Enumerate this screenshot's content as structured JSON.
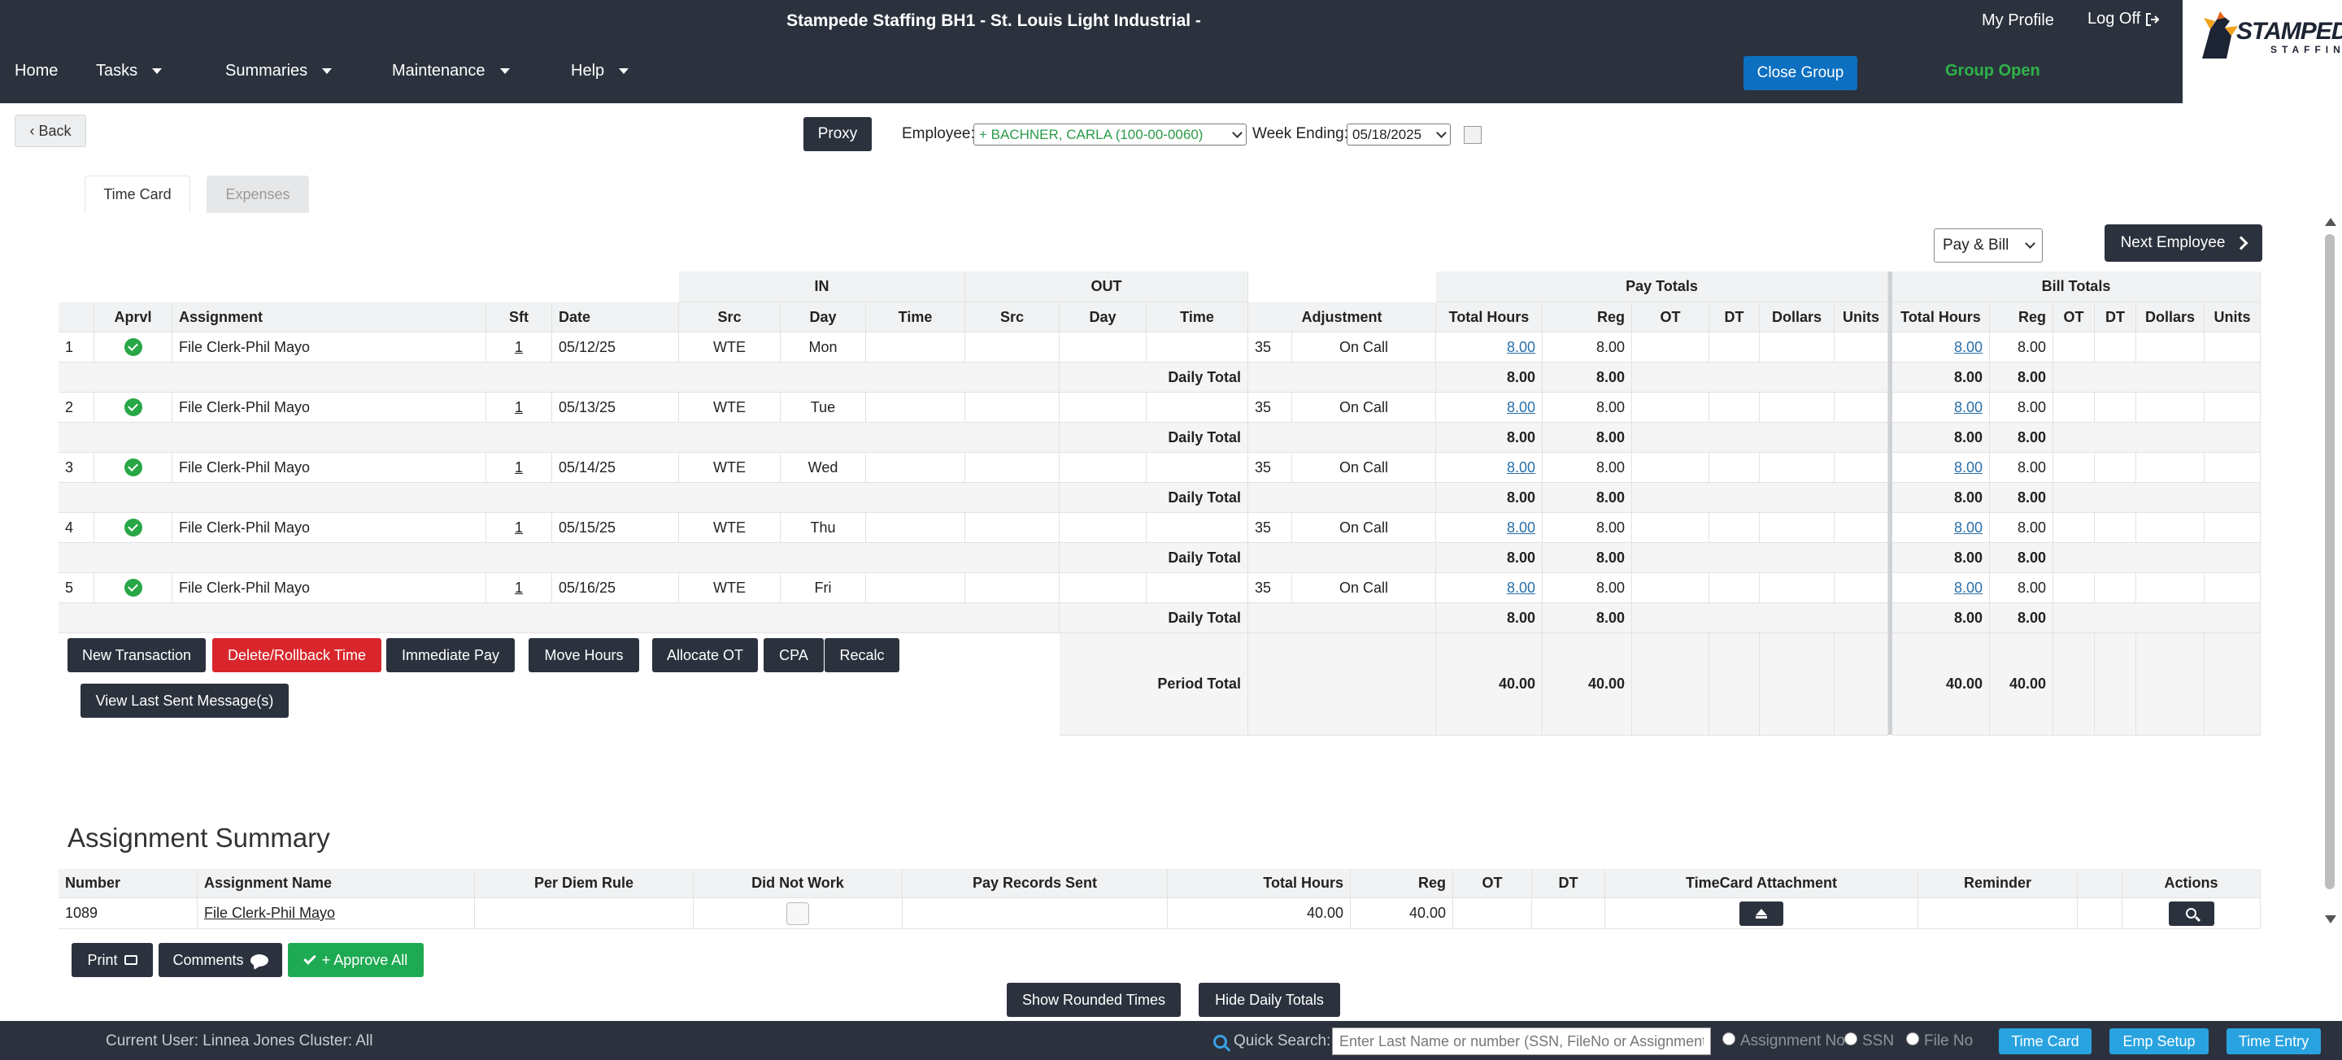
{
  "header": {
    "title": "Stampede Staffing BH1 - St. Louis Light Industrial -",
    "my_profile": "My Profile",
    "log_off": "Log Off"
  },
  "nav": {
    "items": [
      "Home",
      "Tasks",
      "Summaries",
      "Maintenance",
      "Help"
    ],
    "close_group": "Close Group",
    "group_status": "Group Open"
  },
  "logo": {
    "word1": "STAMPEDE",
    "word2": "STAFFING"
  },
  "controls": {
    "back": "Back",
    "proxy": "Proxy",
    "employee_label": "Employee:",
    "employee_value": "+  BACHNER, CARLA (100-00-0060)",
    "week_label": "Week Ending:",
    "week_value": "05/18/2025",
    "view_select": "Pay & Bill",
    "next_employee": "Next Employee"
  },
  "tabs": {
    "time_card": "Time Card",
    "expenses": "Expenses"
  },
  "timecard": {
    "group_headers": {
      "in": "IN",
      "out": "OUT",
      "pay": "Pay Totals",
      "bill": "Bill Totals"
    },
    "columns": [
      "Aprvl",
      "Assignment",
      "Sft",
      "Date",
      "Src",
      "Day",
      "Time",
      "Src",
      "Day",
      "Time",
      "Adjustment",
      "Total Hours",
      "Reg",
      "OT",
      "DT",
      "Dollars",
      "Units",
      "Total Hours",
      "Reg",
      "OT",
      "DT",
      "Dollars",
      "Units"
    ],
    "rows": [
      {
        "num": "1",
        "assignment": "File Clerk-Phil Mayo",
        "sft": "1",
        "date": "05/12/25",
        "src": "WTE",
        "day": "Mon",
        "adj_code": "35",
        "adj_type": "On Call",
        "pay_total": "8.00",
        "pay_reg": "8.00",
        "bill_total": "8.00",
        "bill_reg": "8.00"
      },
      {
        "num": "2",
        "assignment": "File Clerk-Phil Mayo",
        "sft": "1",
        "date": "05/13/25",
        "src": "WTE",
        "day": "Tue",
        "adj_code": "35",
        "adj_type": "On Call",
        "pay_total": "8.00",
        "pay_reg": "8.00",
        "bill_total": "8.00",
        "bill_reg": "8.00"
      },
      {
        "num": "3",
        "assignment": "File Clerk-Phil Mayo",
        "sft": "1",
        "date": "05/14/25",
        "src": "WTE",
        "day": "Wed",
        "adj_code": "35",
        "adj_type": "On Call",
        "pay_total": "8.00",
        "pay_reg": "8.00",
        "bill_total": "8.00",
        "bill_reg": "8.00"
      },
      {
        "num": "4",
        "assignment": "File Clerk-Phil Mayo",
        "sft": "1",
        "date": "05/15/25",
        "src": "WTE",
        "day": "Thu",
        "adj_code": "35",
        "adj_type": "On Call",
        "pay_total": "8.00",
        "pay_reg": "8.00",
        "bill_total": "8.00",
        "bill_reg": "8.00"
      },
      {
        "num": "5",
        "assignment": "File Clerk-Phil Mayo",
        "sft": "1",
        "date": "05/16/25",
        "src": "WTE",
        "day": "Fri",
        "adj_code": "35",
        "adj_type": "On Call",
        "pay_total": "8.00",
        "pay_reg": "8.00",
        "bill_total": "8.00",
        "bill_reg": "8.00"
      }
    ],
    "daily_total_label": "Daily Total",
    "daily_totals": [
      {
        "pay_total": "8.00",
        "pay_reg": "8.00",
        "bill_total": "8.00",
        "bill_reg": "8.00"
      },
      {
        "pay_total": "8.00",
        "pay_reg": "8.00",
        "bill_total": "8.00",
        "bill_reg": "8.00"
      },
      {
        "pay_total": "8.00",
        "pay_reg": "8.00",
        "bill_total": "8.00",
        "bill_reg": "8.00"
      },
      {
        "pay_total": "8.00",
        "pay_reg": "8.00",
        "bill_total": "8.00",
        "bill_reg": "8.00"
      },
      {
        "pay_total": "8.00",
        "pay_reg": "8.00",
        "bill_total": "8.00",
        "bill_reg": "8.00"
      }
    ],
    "period_total_label": "Period Total",
    "period_total": {
      "pay_total": "40.00",
      "pay_reg": "40.00",
      "bill_total": "40.00",
      "bill_reg": "40.00"
    }
  },
  "actions": {
    "new_transaction": "New Transaction",
    "delete_rollback": "Delete/Rollback Time",
    "immediate_pay": "Immediate Pay",
    "move_hours": "Move Hours",
    "allocate_ot": "Allocate OT",
    "cpa": "CPA",
    "recalc": "Recalc",
    "view_last_sent": "View Last Sent Message(s)"
  },
  "summary": {
    "title": "Assignment Summary",
    "columns": [
      "Number",
      "Assignment Name",
      "Per Diem Rule",
      "Did Not Work",
      "Pay Records Sent",
      "Total Hours",
      "Reg",
      "OT",
      "DT",
      "TimeCard Attachment",
      "Reminder",
      "Actions"
    ],
    "row": {
      "number": "1089",
      "name": "File Clerk-Phil Mayo",
      "total_hours": "40.00",
      "reg": "40.00"
    }
  },
  "bottom_actions": {
    "print": "Print",
    "comments": "Comments",
    "approve_all": "+ Approve All",
    "show_rounded": "Show Rounded Times",
    "hide_daily": "Hide Daily Totals"
  },
  "footer": {
    "current_user": "Current User:  Linnea Jones   Cluster:  All",
    "quick_search": "Quick Search:",
    "search_placeholder": "Enter Last Name or number (SSN, FileNo or Assignment)",
    "radio_assignment": "Assignment No",
    "radio_ssn": "SSN",
    "radio_fileno": "File No",
    "time_card": "Time Card",
    "emp_setup": "Emp Setup",
    "time_entry": "Time Entry"
  }
}
